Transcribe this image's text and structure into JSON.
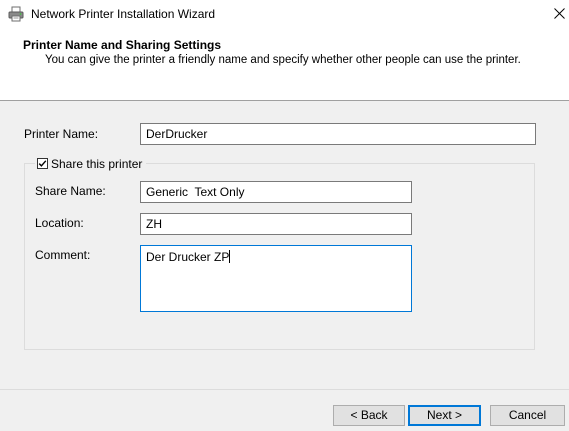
{
  "window": {
    "title": "Network Printer Installation Wizard",
    "title_icon": "printer-icon",
    "close_icon": "close-icon"
  },
  "header": {
    "title": "Printer Name and Sharing Settings",
    "subtitle": "You can give the printer a friendly name and specify whether other people can use the printer."
  },
  "form": {
    "printer_name": {
      "label": "Printer Name:",
      "value": "DerDrucker"
    },
    "share": {
      "label": "Share this printer",
      "checked": true,
      "share_name": {
        "label": "Share Name:",
        "value": "Generic  Text Only"
      },
      "location": {
        "label": "Location:",
        "value": "ZH"
      },
      "comment": {
        "label": "Comment:",
        "value": "Der Drucker ZP"
      }
    }
  },
  "buttons": {
    "back": "< Back",
    "next": "Next >",
    "cancel": "Cancel"
  },
  "colors": {
    "focus_accent": "#0078d7",
    "dialog_background": "#f0f0f0"
  }
}
